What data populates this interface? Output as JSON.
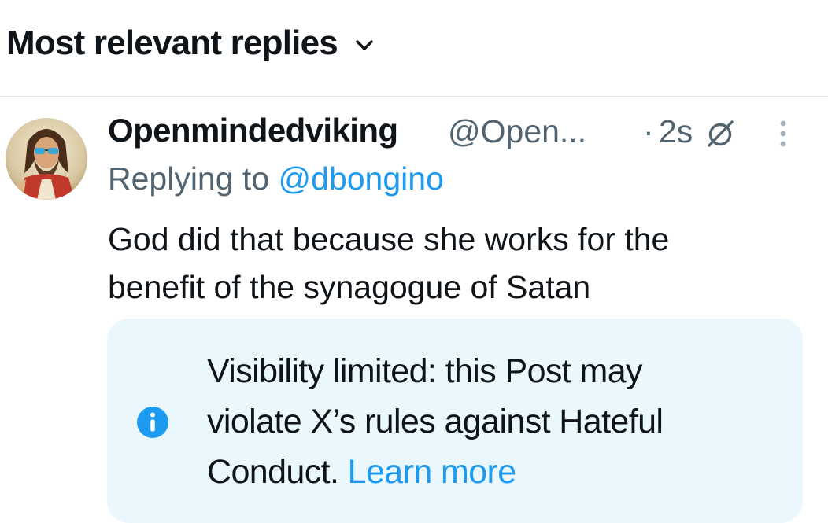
{
  "sort": {
    "label": "Most relevant replies"
  },
  "post": {
    "display_name": "Openmindedviking",
    "handle": "@Open...",
    "separator": "·",
    "time": "2s",
    "replying_prefix": "Replying to",
    "replying_to": "@dbongino",
    "body_line1": "God did that because she works for the",
    "body_line2": "benefit of the synagogue of Satan"
  },
  "notice": {
    "line1": "Visibility limited: this Post may",
    "line2": "violate X’s rules against Hateful",
    "line3": "Conduct.",
    "link": "Learn more"
  },
  "icons": {
    "sort_chevron": "chevron-down-icon",
    "grok": "grok-icon",
    "more": "more-vertical-icon",
    "info": "info-circle-icon"
  },
  "colors": {
    "text_primary": "#0f1419",
    "text_secondary": "#536471",
    "accent": "#1d9bf0",
    "notice_background": "#eaf7fd",
    "divider": "#dfe3e6"
  }
}
